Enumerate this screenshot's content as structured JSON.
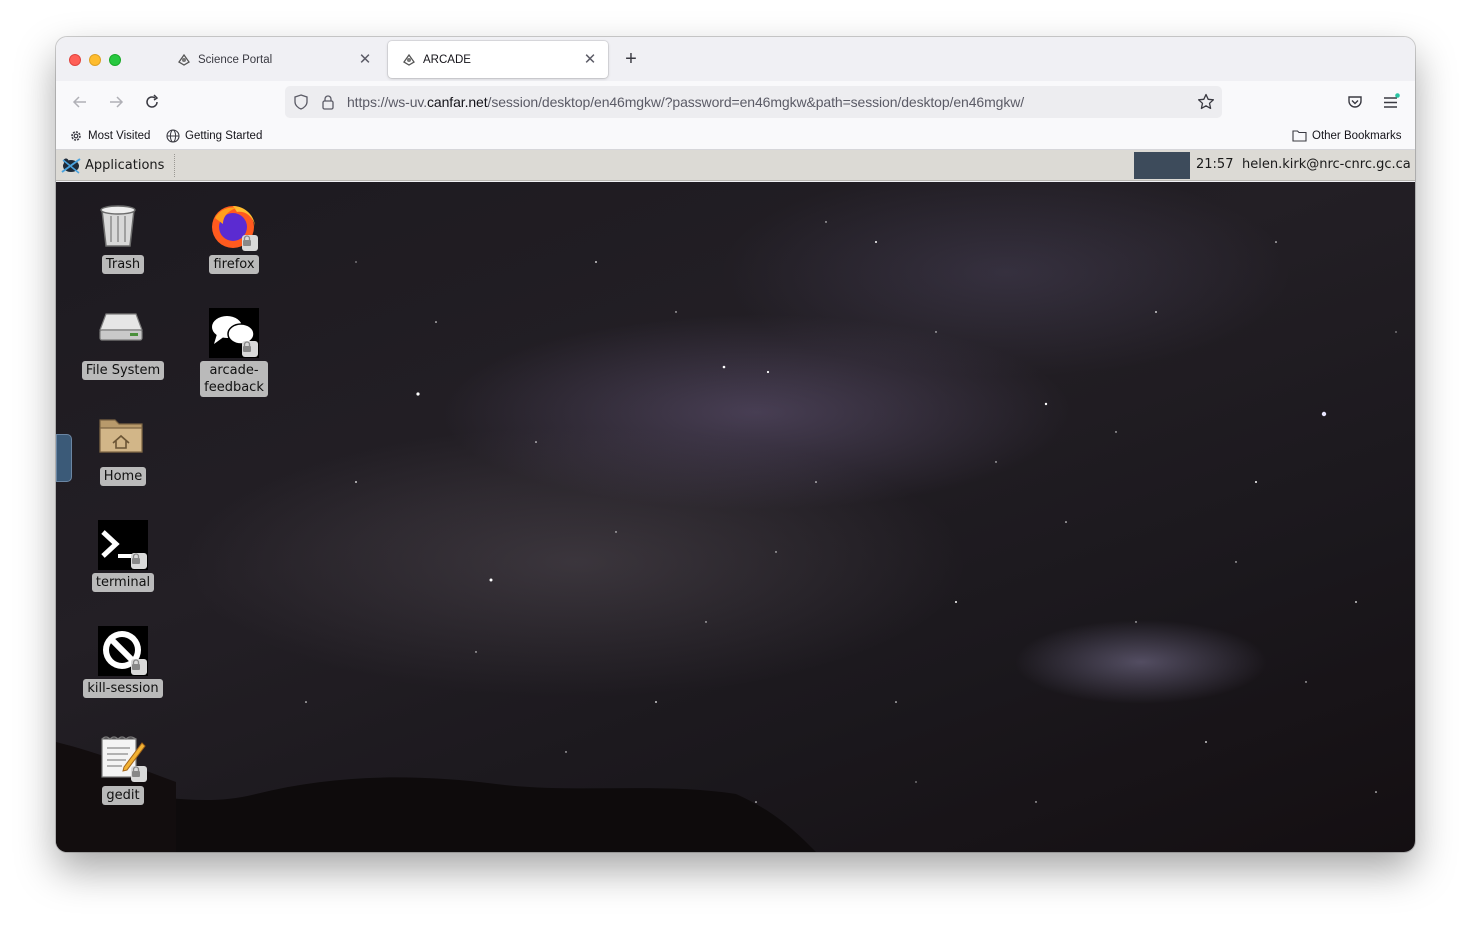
{
  "browser": {
    "tabs": [
      {
        "title": "Science Portal",
        "active": false
      },
      {
        "title": "ARCADE",
        "active": true
      }
    ],
    "url": {
      "prefix": "https://ws-uv.",
      "host": "canfar.net",
      "path": "/session/desktop/en46mgkw/?password=en46mgkw&path=session/desktop/en46mgkw/"
    },
    "bookmarks": {
      "most_visited": "Most Visited",
      "getting_started": "Getting Started",
      "other": "Other Bookmarks"
    }
  },
  "desktop": {
    "panel": {
      "applications_label": "Applications",
      "clock": "21:57",
      "user": "helen.kirk@nrc-cnrc.gc.ca"
    },
    "icons": {
      "trash": "Trash",
      "firefox": "firefox",
      "filesystem": "File System",
      "arcade_feedback_1": "arcade-",
      "arcade_feedback_2": "feedback",
      "home": "Home",
      "terminal": "terminal",
      "kill_session": "kill-session",
      "gedit": "gedit"
    }
  },
  "colors": {
    "accent_tab": "#ffffff",
    "panel": "#dcdad5",
    "workspace": "#3d4b5b"
  }
}
